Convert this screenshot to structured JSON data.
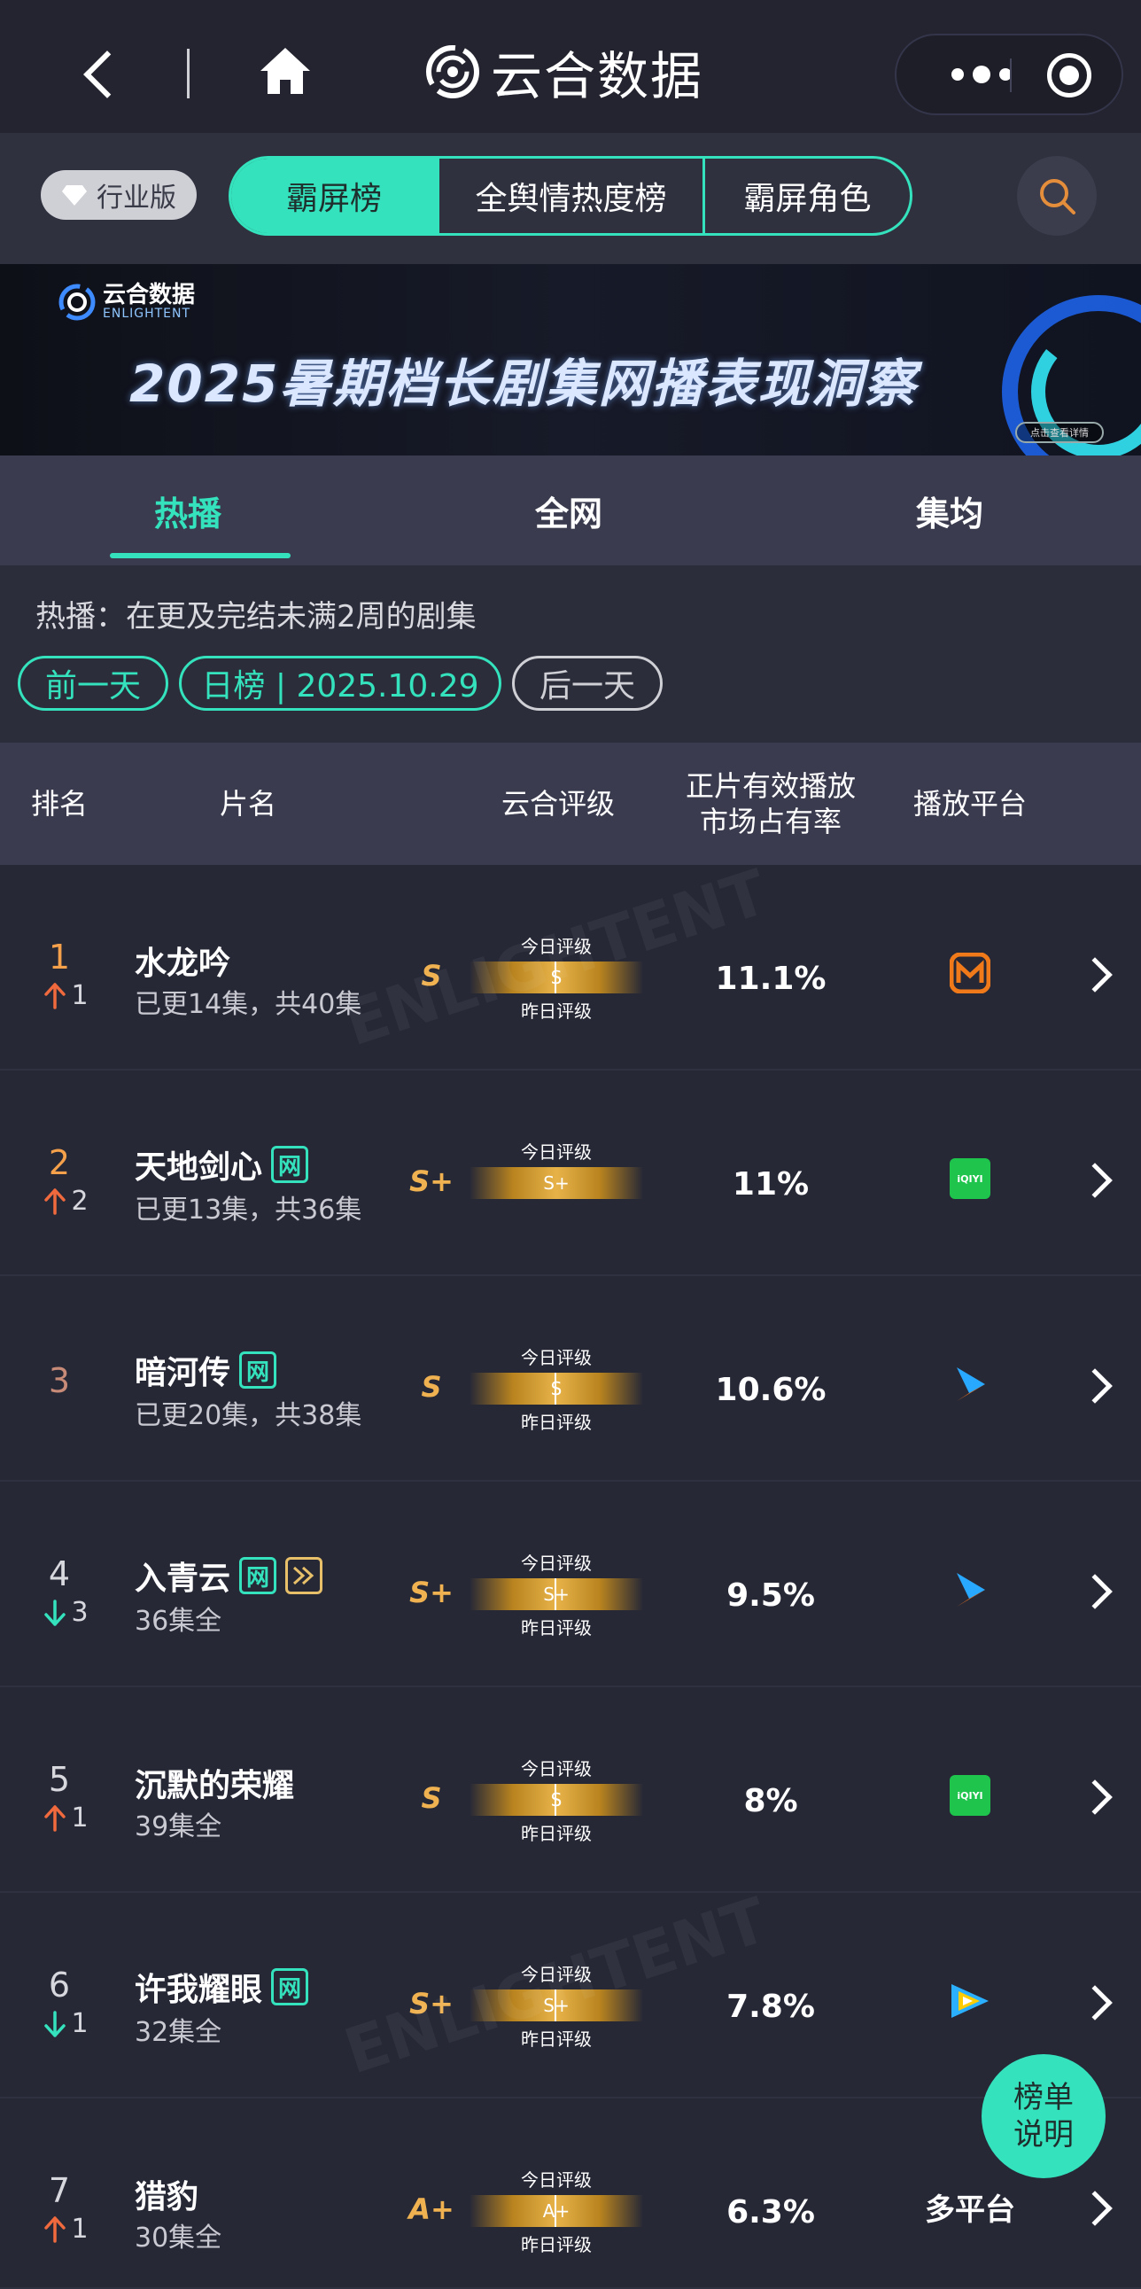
{
  "header": {
    "app_title": "云合数据"
  },
  "top_nav": {
    "industry_label": "行业版",
    "tabs": [
      "霸屏榜",
      "全舆情热度榜",
      "霸屏角色"
    ],
    "active_tab": 0
  },
  "banner": {
    "brand_cn": "云合数据",
    "brand_en": "ENLIGHTENT",
    "headline": "2025暑期档长剧集网播表现洞察",
    "cta": "点击查看详情"
  },
  "sub_tabs": {
    "items": [
      "热播",
      "全网",
      "集均"
    ],
    "active": 0
  },
  "info": {
    "description": "热播：在更及完结未满2周的剧集",
    "prev_day": "前一天",
    "current": "日榜 | 2025.10.29",
    "next_day": "后一天"
  },
  "table": {
    "headers": {
      "rank": "排名",
      "title": "片名",
      "rating": "云合评级",
      "share_line1": "正片有效播放",
      "share_line2": "市场占有率",
      "platform": "播放平台"
    },
    "today_label": "今日评级",
    "yesterday_label": "昨日评级",
    "rows": [
      {
        "rank": "1",
        "change_dir": "up",
        "change": "1",
        "title": "水龙吟",
        "tags": [],
        "episodes": "已更14集，共40集",
        "grade": "S",
        "today": "S",
        "share": "11.1%",
        "platform": "mango-tv-icon",
        "platform_text": ""
      },
      {
        "rank": "2",
        "change_dir": "up",
        "change": "2",
        "title": "天地剑心",
        "tags": [
          "网"
        ],
        "episodes": "已更13集，共36集",
        "grade": "S+",
        "today": "S+",
        "share": "11%",
        "platform": "iqiyi-icon",
        "platform_text": "iQIYI"
      },
      {
        "rank": "3",
        "change_dir": "",
        "change": "",
        "title": "暗河传",
        "tags": [
          "网"
        ],
        "episodes": "已更20集，共38集",
        "grade": "S",
        "today": "S",
        "share": "10.6%",
        "platform": "youku-icon",
        "platform_text": ""
      },
      {
        "rank": "4",
        "change_dir": "down",
        "change": "3",
        "title": "入青云",
        "tags": [
          "网",
          "ff"
        ],
        "episodes": "36集全",
        "grade": "S+",
        "today": "S+",
        "share": "9.5%",
        "platform": "youku-icon",
        "platform_text": ""
      },
      {
        "rank": "5",
        "change_dir": "up",
        "change": "1",
        "title": "沉默的荣耀",
        "tags": [],
        "episodes": "39集全",
        "grade": "S",
        "today": "S",
        "share": "8%",
        "platform": "iqiyi-icon",
        "platform_text": "iQIYI"
      },
      {
        "rank": "6",
        "change_dir": "down",
        "change": "1",
        "title": "许我耀眼",
        "tags": [
          "网"
        ],
        "episodes": "32集全",
        "grade": "S+",
        "today": "S+",
        "share": "7.8%",
        "platform": "tencent-video-icon",
        "platform_text": ""
      },
      {
        "rank": "7",
        "change_dir": "up",
        "change": "1",
        "title": "猎豹",
        "tags": [],
        "episodes": "30集全",
        "grade": "A+",
        "today": "A+",
        "share": "6.3%",
        "platform": "multi",
        "platform_text": "多平台"
      }
    ]
  },
  "explain_button": {
    "line1": "榜单",
    "line2": "说明"
  },
  "colors": {
    "accent": "#34e3bd",
    "rank_orange": "#f5a04a",
    "up_arrow": "#f06a3e",
    "down_arrow": "#34e3bd",
    "grade_gold": "#f0b251"
  }
}
